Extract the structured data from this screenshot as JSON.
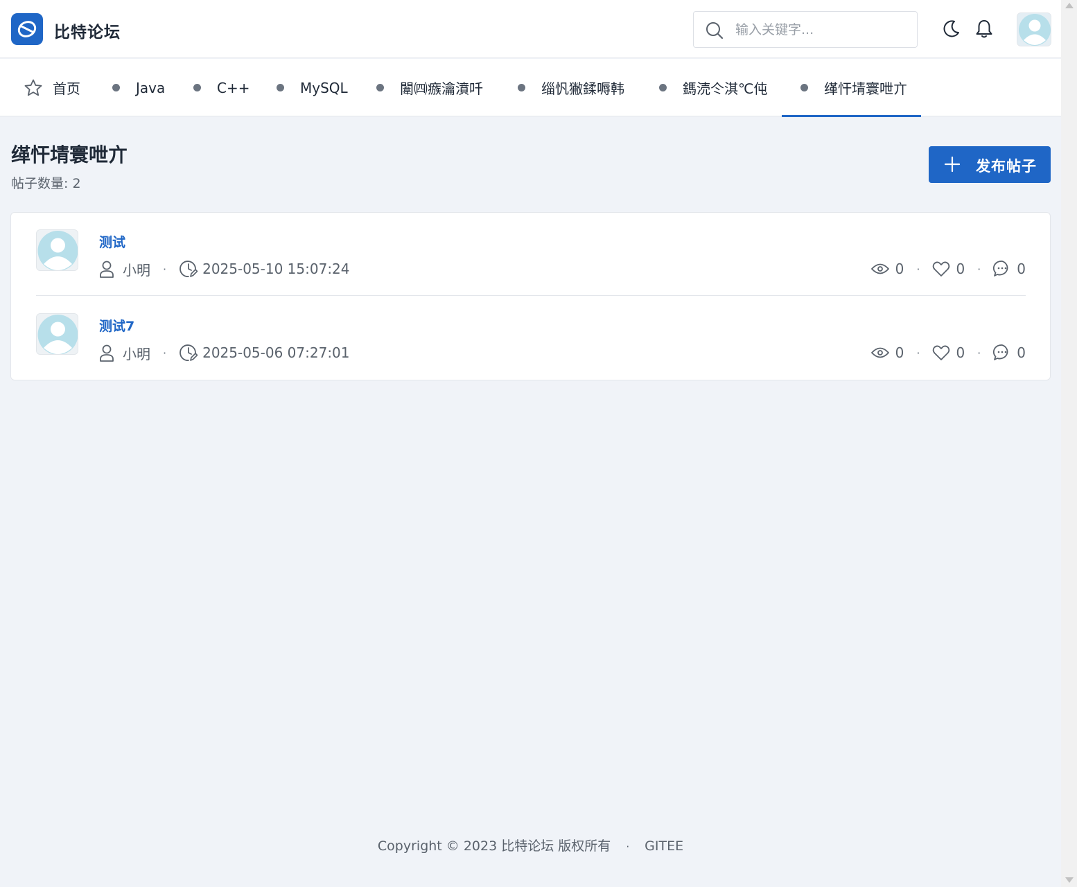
{
  "header": {
    "brand": "比特论坛",
    "search_placeholder": "输入关键字...",
    "icons": [
      "logo-icon",
      "search-icon",
      "moon-icon",
      "bell-icon",
      "user-avatar"
    ]
  },
  "nav": {
    "items": [
      {
        "label": "首页",
        "icon": "star-icon"
      },
      {
        "label": "Java",
        "icon": "dot"
      },
      {
        "label": "C++",
        "icon": "dot"
      },
      {
        "label": "MySQL",
        "icon": "dot"
      },
      {
        "label": "闈㈣瘯瀹濆吀",
        "icon": "dot"
      },
      {
        "label": "缁忛獙鍒嗕韩",
        "icon": "dot"
      },
      {
        "label": "鎷涜仒淇℃伅",
        "icon": "dot"
      },
      {
        "label": "缂忓埥寰呭亣",
        "icon": "dot",
        "active": true
      }
    ]
  },
  "page": {
    "title": "缂忓埥寰呭亣",
    "post_count": "帖子数量: 2",
    "publish_label": "发布帖子"
  },
  "posts": [
    {
      "title": "测试",
      "author": "小明",
      "time": "2025-05-10 15:07:24",
      "views": "0",
      "likes": "0",
      "comments": "0"
    },
    {
      "title": "测试7",
      "author": "小明",
      "time": "2025-05-06 07:27:01",
      "views": "0",
      "likes": "0",
      "comments": "0"
    }
  ],
  "footer": {
    "copyright": "Copyright © 2023 比特论坛 版权所有",
    "link": "GITEE"
  },
  "colors": {
    "primary": "#1f66c6",
    "background": "#f0f3f8",
    "text": "#1f2937",
    "muted": "#5a626c"
  }
}
